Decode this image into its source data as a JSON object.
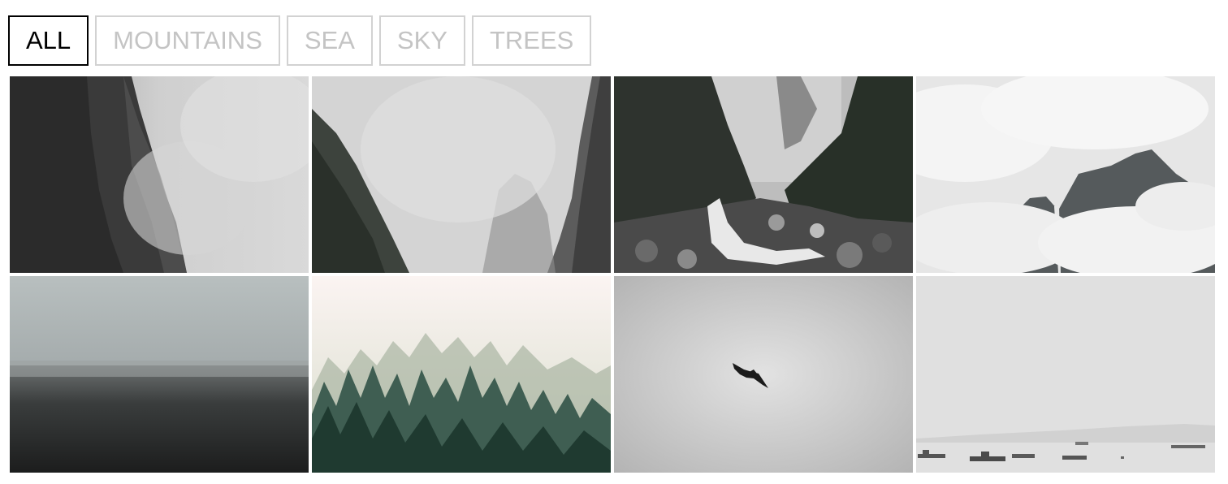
{
  "filters": [
    {
      "label": "ALL",
      "active": true
    },
    {
      "label": "MOUNTAINS",
      "active": false
    },
    {
      "label": "SEA",
      "active": false
    },
    {
      "label": "SKY",
      "active": false
    },
    {
      "label": "TREES",
      "active": false
    }
  ],
  "gallery": {
    "items": [
      {
        "subject": "foggy cliff left"
      },
      {
        "subject": "foggy canyon"
      },
      {
        "subject": "waterfall river rocks"
      },
      {
        "subject": "clouds over mountain"
      },
      {
        "subject": "dark misty sea"
      },
      {
        "subject": "misty pine forest"
      },
      {
        "subject": "bird in grey sky"
      },
      {
        "subject": "boats in hazy harbor"
      }
    ]
  }
}
